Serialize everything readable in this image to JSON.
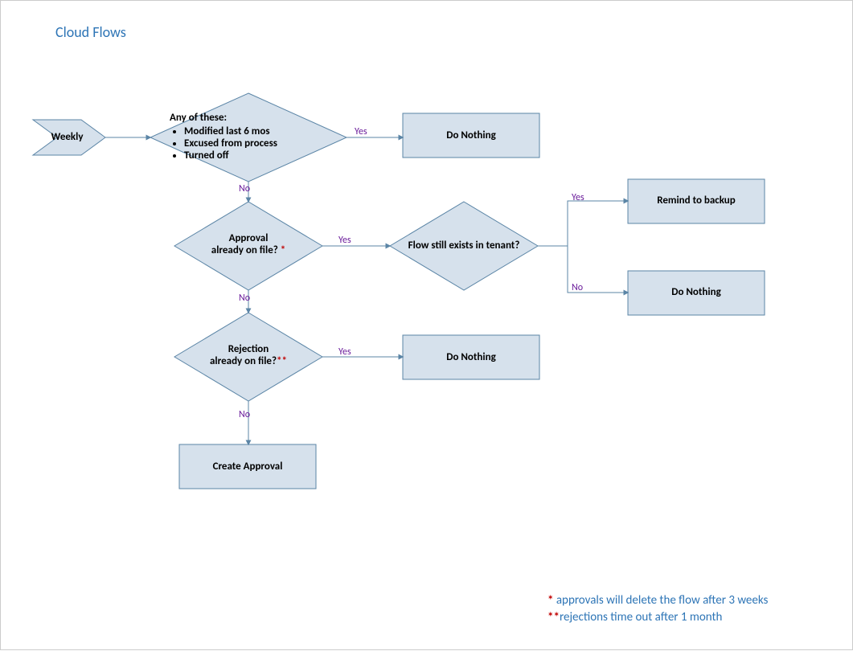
{
  "title": "Cloud Flows",
  "nodes": {
    "start": "Weekly",
    "d1_title": "Any of these:",
    "d1_b1": "Modified last 6 mos",
    "d1_b2": "Excused from process",
    "d1_b3": "Turned off",
    "p1": "Do Nothing",
    "d2_l1": "Approval",
    "d2_l2": "already on file? ",
    "d2_star": "*",
    "d3": "Flow still exists in tenant?",
    "p2": "Remind to backup",
    "p3": "Do Nothing",
    "d4_l1": "Rejection",
    "d4_l2": "already on file?",
    "d4_star": "**",
    "p4": "Do Nothing",
    "p5": "Create Approval"
  },
  "edges": {
    "yes": "Yes",
    "no": "No"
  },
  "footnotes": {
    "f1_star": "* ",
    "f1_text": "approvals will delete the flow after 3 weeks",
    "f2_star": "**",
    "f2_text": "rejections time out after 1 month"
  },
  "chart_data": {
    "type": "flowchart",
    "title": "Cloud Flows",
    "nodes": [
      {
        "id": "start",
        "type": "start-chevron",
        "label": "Weekly"
      },
      {
        "id": "d1",
        "type": "decision",
        "label": "Any of these: Modified last 6 mos; Excused from process; Turned off"
      },
      {
        "id": "p1",
        "type": "process",
        "label": "Do Nothing"
      },
      {
        "id": "d2",
        "type": "decision",
        "label": "Approval already on file? *"
      },
      {
        "id": "d3",
        "type": "decision",
        "label": "Flow still exists in tenant?"
      },
      {
        "id": "p2",
        "type": "process",
        "label": "Remind to backup"
      },
      {
        "id": "p3",
        "type": "process",
        "label": "Do Nothing"
      },
      {
        "id": "d4",
        "type": "decision",
        "label": "Rejection already on file? **"
      },
      {
        "id": "p4",
        "type": "process",
        "label": "Do Nothing"
      },
      {
        "id": "p5",
        "type": "process",
        "label": "Create Approval"
      }
    ],
    "edges": [
      {
        "from": "start",
        "to": "d1",
        "label": ""
      },
      {
        "from": "d1",
        "to": "p1",
        "label": "Yes"
      },
      {
        "from": "d1",
        "to": "d2",
        "label": "No"
      },
      {
        "from": "d2",
        "to": "d3",
        "label": "Yes"
      },
      {
        "from": "d3",
        "to": "p2",
        "label": "Yes"
      },
      {
        "from": "d3",
        "to": "p3",
        "label": "No"
      },
      {
        "from": "d2",
        "to": "d4",
        "label": "No"
      },
      {
        "from": "d4",
        "to": "p4",
        "label": "Yes"
      },
      {
        "from": "d4",
        "to": "p5",
        "label": "No"
      }
    ],
    "footnotes": [
      "* approvals will delete the flow after 3 weeks",
      "**rejections time out after 1 month"
    ]
  }
}
